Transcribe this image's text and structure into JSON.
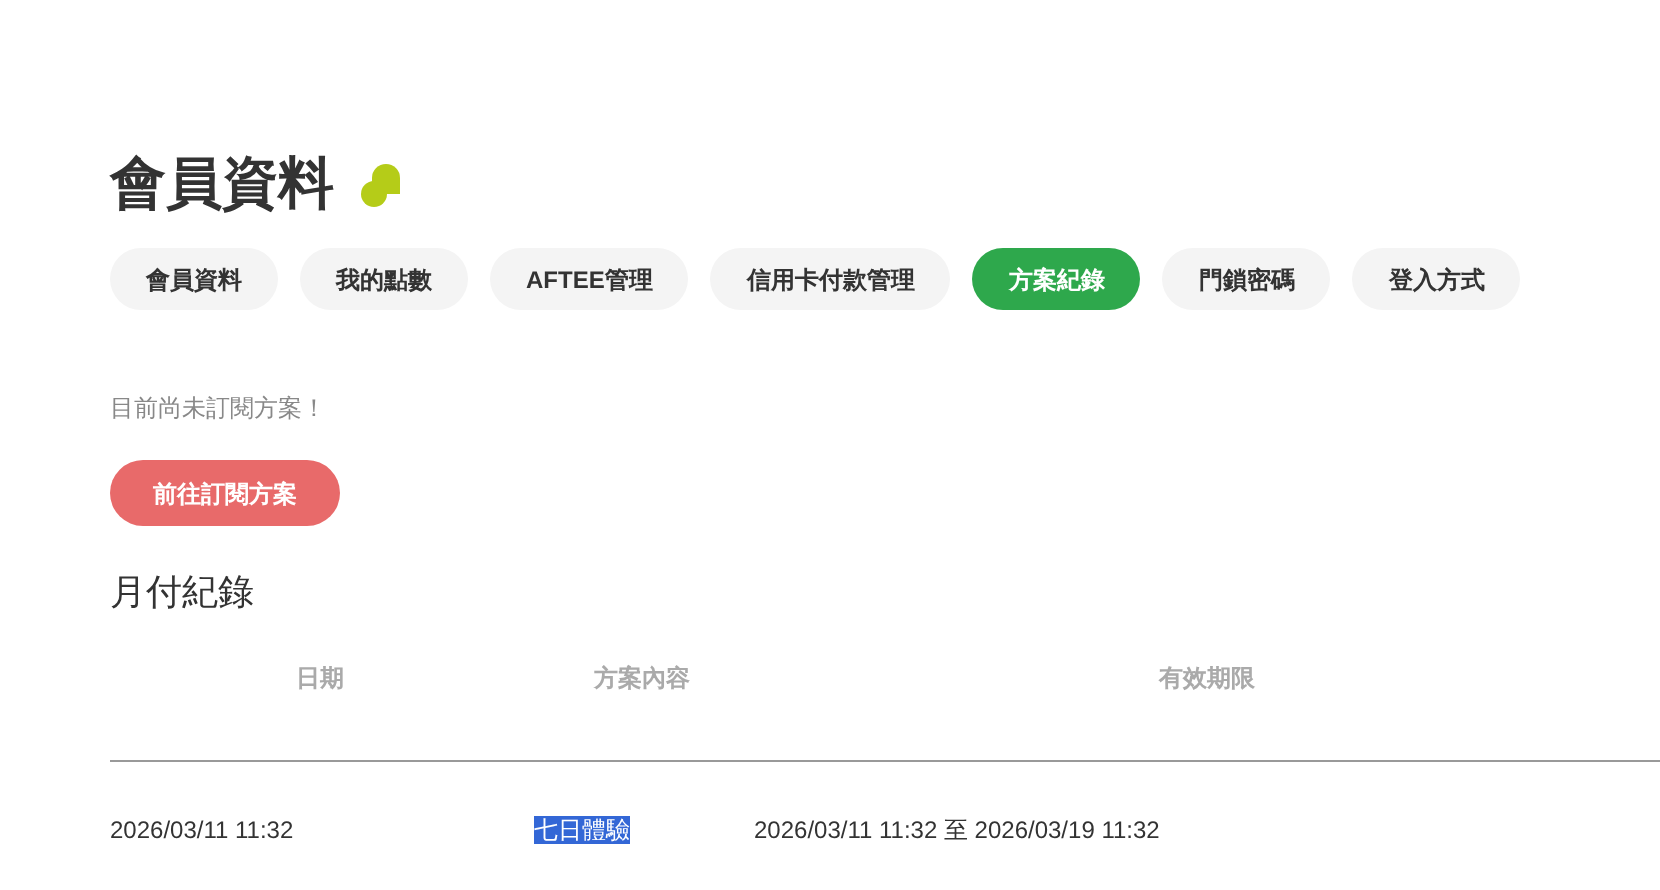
{
  "page_title": "會員資料",
  "tabs": [
    {
      "label": "會員資料",
      "selected": false
    },
    {
      "label": "我的點數",
      "selected": false
    },
    {
      "label": "AFTEE管理",
      "selected": false
    },
    {
      "label": "信用卡付款管理",
      "selected": false
    },
    {
      "label": "方案紀錄",
      "selected": true
    },
    {
      "label": "門鎖密碼",
      "selected": false
    },
    {
      "label": "登入方式",
      "selected": false
    }
  ],
  "notice": "目前尚未訂閱方案！",
  "subscribe_button": "前往訂閱方案",
  "section_title": "月付紀錄",
  "table": {
    "columns": [
      "日期",
      "方案內容",
      "有效期限"
    ],
    "rows": [
      {
        "date": "2026/03/11 11:32",
        "plan": "七日體驗",
        "plan_highlighted": true,
        "validity": "2026/03/11 11:32 至 2026/03/19 11:32"
      }
    ]
  }
}
